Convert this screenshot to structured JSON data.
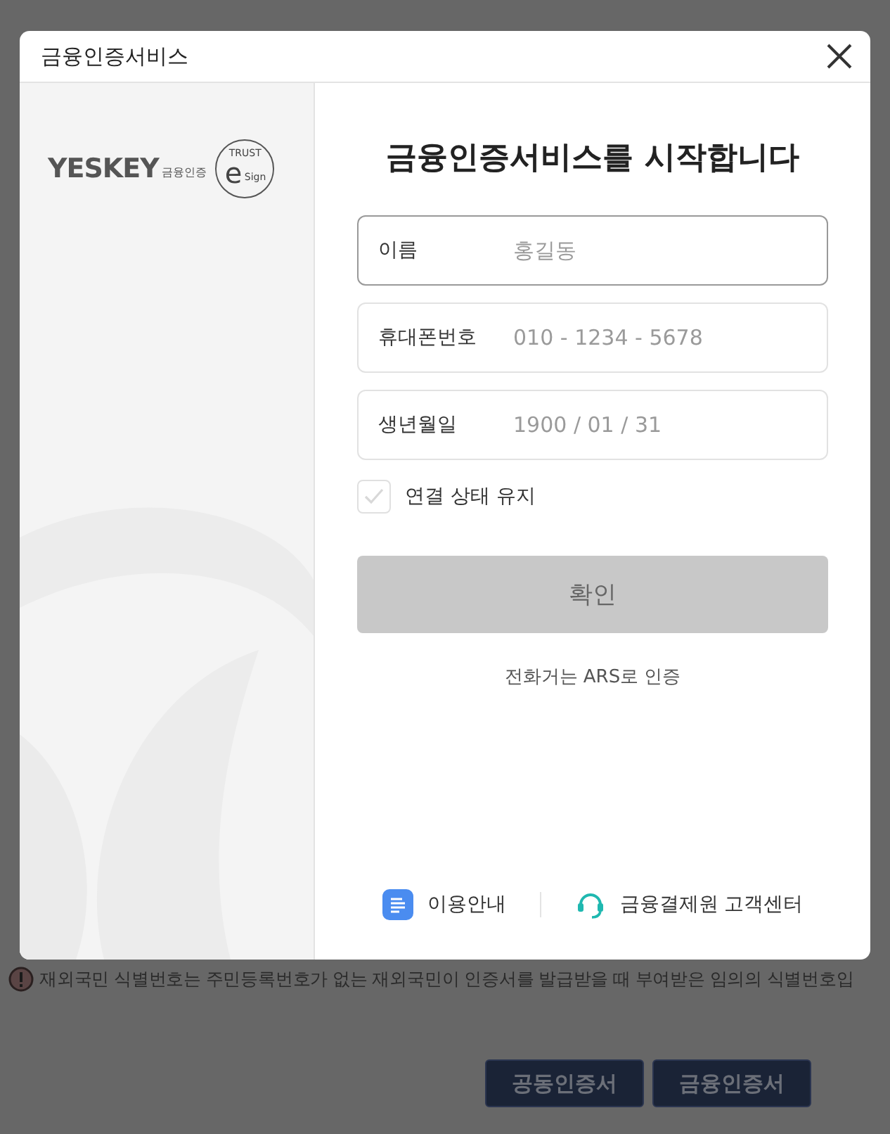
{
  "background": {
    "notice": "재외국민 식별번호는 주민등록번호가 없는 재외국민이 인증서를 발급받을 때 부여받은 임의의 식별번호입",
    "buttons": [
      "공동인증서",
      "금융인증서"
    ]
  },
  "dialog": {
    "title": "금융인증서비스",
    "logo": {
      "brand": "YESKEY",
      "sub": "금융인증",
      "seal_top": "TRUST",
      "seal_mid": "e",
      "seal_bottom": "Sign"
    },
    "heading": "금융인증서비스를 시작합니다",
    "fields": [
      {
        "label": "이름",
        "placeholder": "홍길동",
        "focused": true
      },
      {
        "label": "휴대폰번호",
        "placeholder": "010 - 1234 - 5678",
        "focused": false
      },
      {
        "label": "생년월일",
        "placeholder": "1900 / 01 / 31",
        "focused": false
      }
    ],
    "keep_login": {
      "label": "연결 상태 유지",
      "checked": false
    },
    "confirm": {
      "label": "확인",
      "disabled": true
    },
    "ars_link": "전화거는 ARS로 인증",
    "footer": [
      {
        "kind": "guide",
        "label": "이용안내"
      },
      {
        "kind": "support",
        "label": "금융결제원 고객센터"
      }
    ]
  }
}
